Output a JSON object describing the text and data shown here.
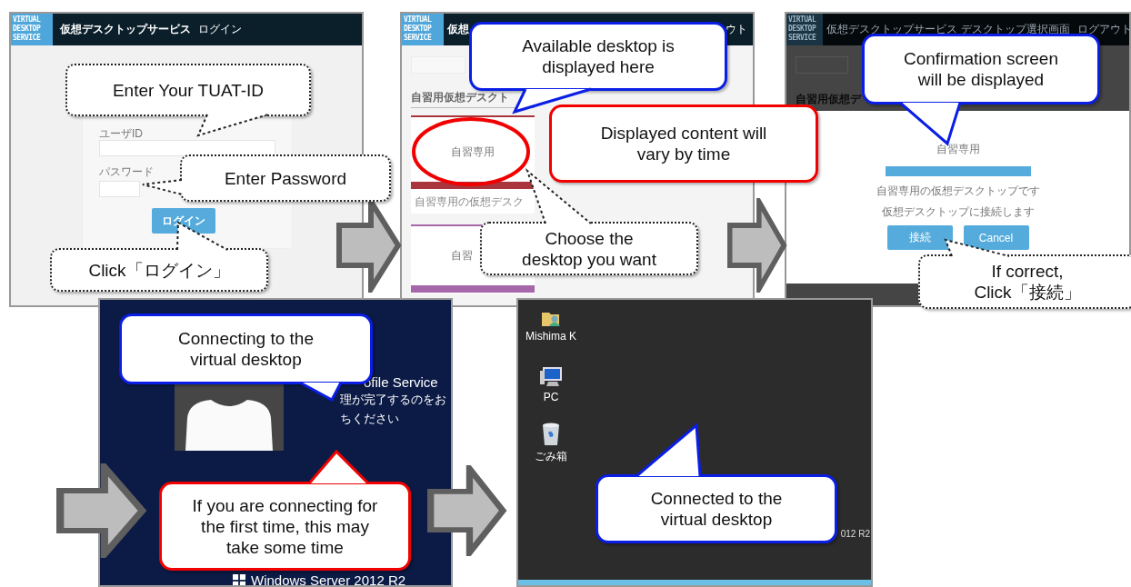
{
  "screens": [
    {
      "kind": "login",
      "logo": "VIRTUAL\nDESKTOP\nSERVICE",
      "title": "仮想デスクトップサービス",
      "subtitle": "ログイン",
      "user_label": "ユーザID",
      "password_label": "パスワード",
      "button": "ログイン"
    },
    {
      "kind": "select",
      "logo": "VIRTUAL\nDESKTOP\nSERVICE",
      "title": "仮想",
      "header_right": "ウト",
      "section": "自習用仮想デスクト",
      "cards": [
        {
          "title": "自習専用",
          "description": "自習専用の仮想デスク",
          "color": "#a8363c"
        },
        {
          "title": "自習",
          "color": "#a567a9"
        }
      ]
    },
    {
      "kind": "confirm",
      "logo": "VIRTUAL\nDESKTOP\nSERVICE",
      "title": "仮想デスクトップサービス",
      "subtitle": "デスクトップ選択画面",
      "logout": "ログアウト",
      "section": "自習用仮想デ",
      "dialog": {
        "title": "自習専用",
        "description": "自習専用の仮想デスクトップです",
        "message": "仮想デスクトップに接続します",
        "buttons": [
          "接続",
          "Cancel"
        ]
      }
    },
    {
      "kind": "signin",
      "status": "ofile Service",
      "message_lines": [
        "理が完了するのをお",
        "ちください"
      ],
      "footer": "Windows Server 2012 R2"
    },
    {
      "kind": "desktop",
      "icons": [
        {
          "kind": "user",
          "label": "Mishima K"
        },
        {
          "kind": "computer",
          "label": "PC"
        },
        {
          "kind": "bin",
          "label": "ごみ箱"
        }
      ],
      "edition": "012 R2"
    }
  ],
  "callouts": [
    {
      "kind": "tip",
      "text": "Enter Your TUAT-ID"
    },
    {
      "kind": "tip",
      "text": "Enter Password"
    },
    {
      "kind": "tip",
      "text": "Click「ログイン」"
    },
    {
      "kind": "info",
      "text": "Available desktop is\ndisplayed here"
    },
    {
      "kind": "alert",
      "text": "Displayed content will\nvary by time"
    },
    {
      "kind": "tip",
      "text": "Choose the\ndesktop you want"
    },
    {
      "kind": "info",
      "text": "Confirmation screen\nwill be displayed"
    },
    {
      "kind": "tip",
      "text": "If correct,\nClick「接続」"
    },
    {
      "kind": "info",
      "text": "Connecting to the\nvirtual desktop"
    },
    {
      "kind": "alert",
      "text": "If you are connecting for\nthe first time, this may\ntake some time"
    },
    {
      "kind": "info",
      "text": "Connected to the\nvirtual desktop"
    }
  ]
}
